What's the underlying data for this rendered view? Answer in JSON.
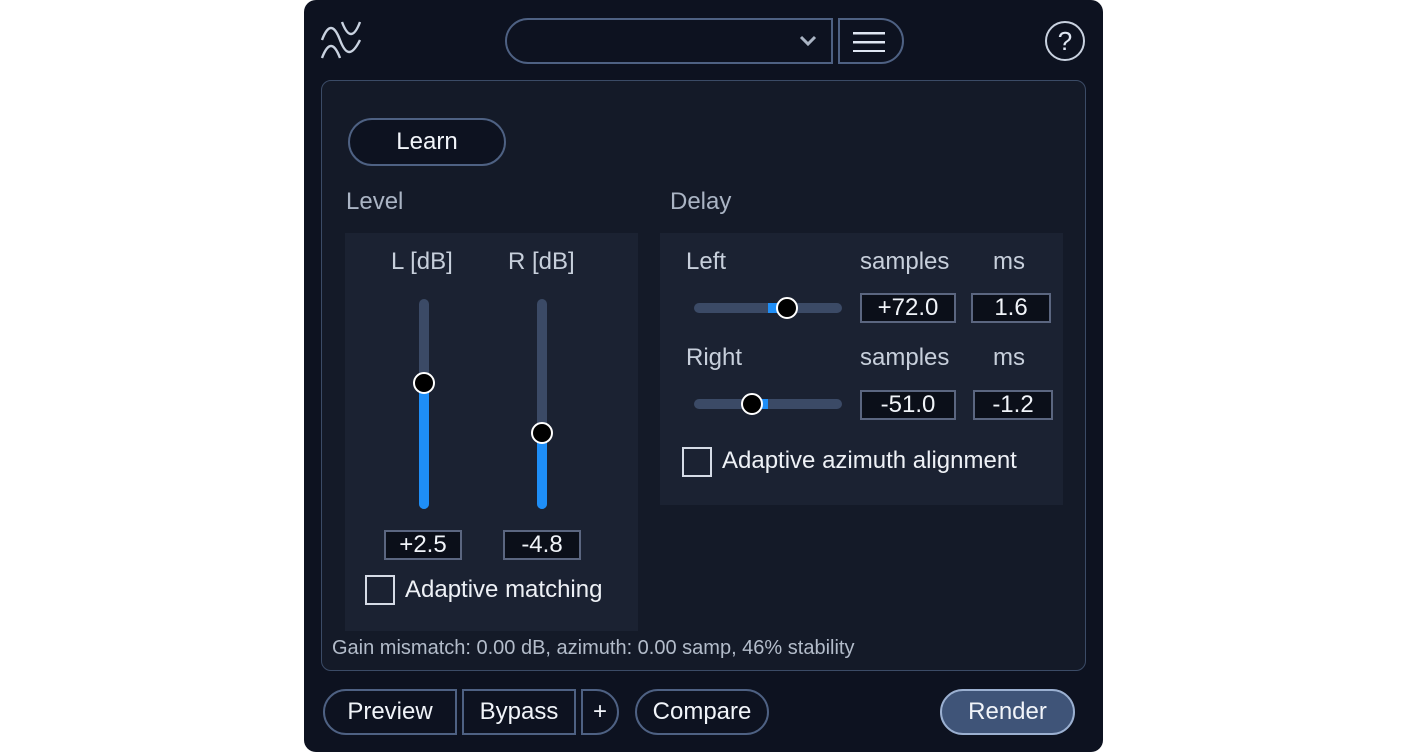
{
  "header": {
    "logo_icon": "sine-wave-logo-icon",
    "preset": {
      "value": "",
      "icon": "chevron-down-icon"
    },
    "menu_icon": "hamburger-menu-icon",
    "help_label": "?"
  },
  "learn_label": "Learn",
  "level": {
    "title": "Level",
    "left": {
      "label": "L [dB]",
      "value": "+2.5",
      "fill_fraction": 0.6
    },
    "right": {
      "label": "R [dB]",
      "value": "-4.8",
      "fill_fraction": 0.36
    },
    "adaptive_matching": {
      "label": "Adaptive matching",
      "checked": false
    }
  },
  "delay": {
    "title": "Delay",
    "left": {
      "label": "Left",
      "samples_label": "samples",
      "ms_label": "ms",
      "samples": "+72.0",
      "ms": "1.6",
      "position": 0.63
    },
    "right": {
      "label": "Right",
      "samples_label": "samples",
      "ms_label": "ms",
      "samples": "-51.0",
      "ms": "-1.2",
      "position": 0.39
    },
    "adaptive_azimuth": {
      "label": "Adaptive azimuth alignment",
      "checked": false
    }
  },
  "status": "Gain mismatch: 0.00 dB, azimuth: 0.00 samp, 46% stability",
  "footer": {
    "preview": "Preview",
    "bypass": "Bypass",
    "plus": "+",
    "compare": "Compare",
    "render": "Render"
  },
  "colors": {
    "accent": "#1e8ef7",
    "background": "#0d1220",
    "panel": "#141a28",
    "render": "#3f5478"
  }
}
